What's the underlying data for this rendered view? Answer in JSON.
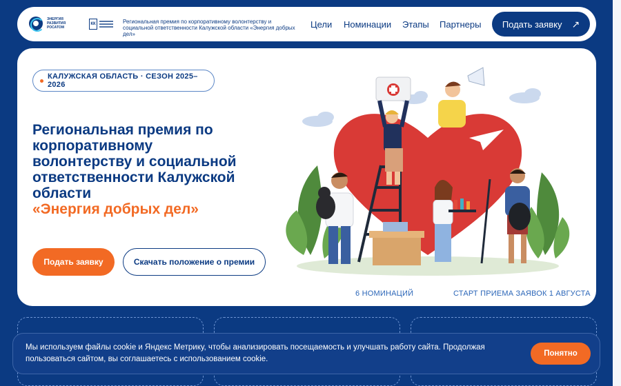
{
  "brand": {
    "logo_text": "ЭНЕРГИЯ РАЗВИТИЯ РОСАТОМ",
    "partner_logo_text": "КК",
    "description": "Региональная премия по корпоративному волонтерству и социальной ответственности Калужской области «Энергия добрых дел»"
  },
  "nav": {
    "links": [
      "Цели",
      "Номинации",
      "Этапы",
      "Партнеры"
    ],
    "cta_label": "Подать заявку",
    "cta_icon": "arrow-up-right-icon"
  },
  "hero": {
    "badge": "КАЛУЖСКАЯ ОБЛАСТЬ · СЕЗОН 2025–2026",
    "title": "Региональная премия по корпоративному волонтерству и социальной ответственности Калужской области",
    "title_accent": "«Энергия добрых дел»",
    "primary_button": "Подать заявку",
    "secondary_button": "Скачать положение о премии",
    "stat_1": "6 НОМИНАЦИЙ",
    "stat_2": "СТАРТ ПРИЕМА ЗАЯВОК 1 АВГУСТА"
  },
  "cookie": {
    "text": "Мы используем файлы cookie и Яндекс Метрику, чтобы анализировать посещаемость и улучшать работу сайта. Продолжая пользоваться сайтом, вы соглашаетесь с использованием cookie.",
    "button": "Понятно"
  },
  "colors": {
    "brand_blue": "#0b3a82",
    "accent_orange": "#f26a24",
    "heart_red": "#d93a36"
  }
}
